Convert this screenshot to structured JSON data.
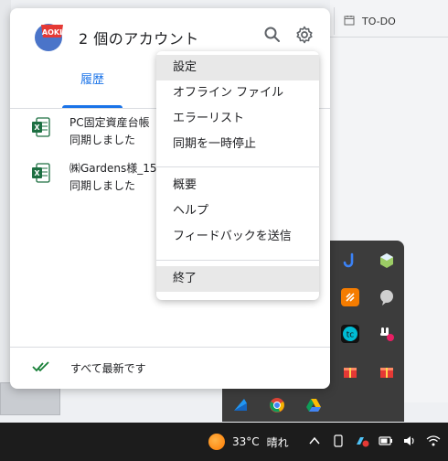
{
  "background": {
    "app_tab_label": "TO-DO"
  },
  "popup": {
    "account_title": "2 個のアカウント",
    "avatar_text": "AOKI",
    "tabs": [
      {
        "label": "履歴"
      }
    ],
    "files": [
      {
        "name": "PC固定資産台帳",
        "status": "同期しました",
        "icon": "excel-icon"
      },
      {
        "name": "㈱Gardens様_15",
        "status": "同期しました",
        "icon": "excel-icon"
      }
    ],
    "footer_text": "すべて最新です",
    "icons": [
      "search-icon",
      "settings-gear-icon",
      "check-all-icon"
    ]
  },
  "menu": {
    "groups": [
      [
        {
          "label": "設定",
          "highlighted": true
        },
        {
          "label": "オフライン ファイル"
        },
        {
          "label": "エラーリスト"
        },
        {
          "label": "同期を一時停止"
        }
      ],
      [
        {
          "label": "概要"
        },
        {
          "label": "ヘルプ"
        },
        {
          "label": "フィードバックを送信"
        }
      ],
      [
        {
          "label": "終了",
          "highlighted": true
        }
      ]
    ]
  },
  "taskbar": {
    "temperature": "33°C",
    "weather": "晴れ"
  },
  "colors": {
    "accent": "#1a73e8",
    "menu_highlight": "#e8e8e8",
    "excel_green": "#1d6f42",
    "check_green": "#188038"
  }
}
